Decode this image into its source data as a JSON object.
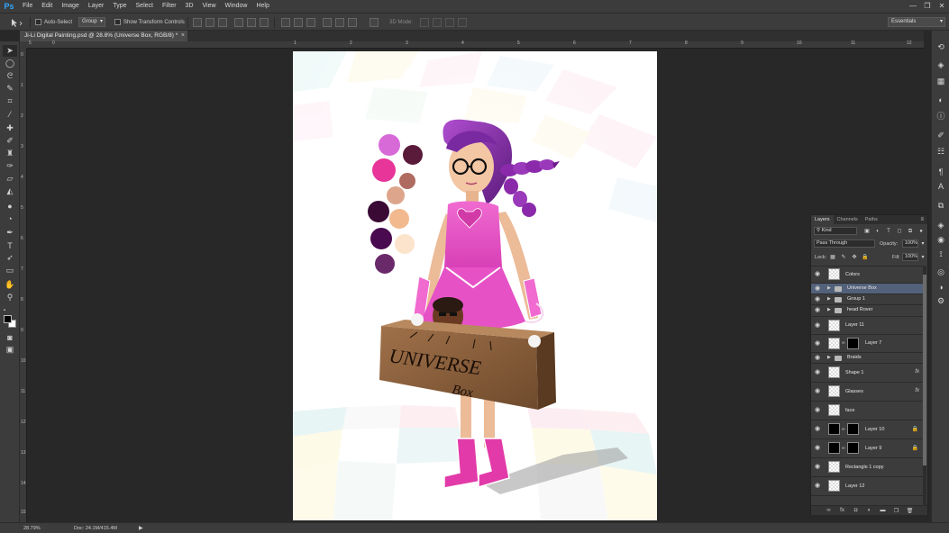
{
  "app": {
    "logo": "Ps"
  },
  "menu": [
    "File",
    "Edit",
    "Image",
    "Layer",
    "Type",
    "Select",
    "Filter",
    "3D",
    "View",
    "Window",
    "Help"
  ],
  "window_controls": [
    "—",
    "❐",
    "✕"
  ],
  "options": {
    "auto_select_label": "Auto-Select",
    "auto_select_value": "Group",
    "show_transform_label": "Show Transform Controls",
    "mode_3d_label": "3D Mode:",
    "workspace": "Essentials"
  },
  "document": {
    "tab_title": "Ji-Li Digital Painting.psd @ 28.8% (Universe Box, RGB/8) *",
    "close": "×"
  },
  "rulers": {
    "top": [
      "5",
      "0",
      "1",
      "2",
      "3",
      "4",
      "5",
      "6",
      "7",
      "8",
      "9",
      "10",
      "11",
      "12",
      "13"
    ],
    "left": [
      "0",
      "1",
      "2",
      "3",
      "4",
      "5",
      "6",
      "7",
      "8",
      "9",
      "10",
      "11",
      "12",
      "13",
      "14",
      "15"
    ]
  },
  "painting": {
    "box_text": "UNIVERSE",
    "box_subtext": "Box",
    "palette_colors": [
      "#d86ad8",
      "#5a1a3a",
      "#e8359a",
      "#b06b60",
      "#dca58c",
      "#3a0a34",
      "#f2b98e",
      "#4a0a50",
      "#fbe3cc",
      "#6a2a6a"
    ]
  },
  "layers_panel": {
    "tabs": [
      "Layers",
      "Channels",
      "Paths"
    ],
    "kind_label": "Kind",
    "blend_mode": "Pass Through",
    "opacity_label": "Opacity:",
    "opacity_value": "100%",
    "lock_label": "Lock:",
    "fill_label": "Fill:",
    "fill_value": "100%",
    "layers": [
      {
        "name": "Colors",
        "type": "layer"
      },
      {
        "name": "Universe Box",
        "type": "group",
        "selected": true
      },
      {
        "name": "Group 1",
        "type": "group"
      },
      {
        "name": "head Rover",
        "type": "group"
      },
      {
        "name": "Layer 11",
        "type": "layer"
      },
      {
        "name": "Layer 7",
        "type": "masked"
      },
      {
        "name": "Braids",
        "type": "group"
      },
      {
        "name": "Shape 1",
        "type": "layer",
        "fx": true
      },
      {
        "name": "Glasses",
        "type": "layer",
        "fx": true
      },
      {
        "name": "face",
        "type": "layer"
      },
      {
        "name": "Layer 10",
        "type": "masked-dark",
        "locked": true
      },
      {
        "name": "Layer 9",
        "type": "masked-dark",
        "locked": true
      },
      {
        "name": "Rectangle 1 copy",
        "type": "layer"
      },
      {
        "name": "Layer 12",
        "type": "layer"
      }
    ],
    "fx_label": "fx",
    "footer_icons": [
      "link-icon",
      "fx-icon",
      "mask-icon",
      "adjustment-icon",
      "folder-icon",
      "new-layer-icon",
      "trash-icon"
    ]
  },
  "status": {
    "zoom": "28.79%",
    "doc": "Doc: 24.1M/415.4M",
    "arrow": "▶"
  }
}
